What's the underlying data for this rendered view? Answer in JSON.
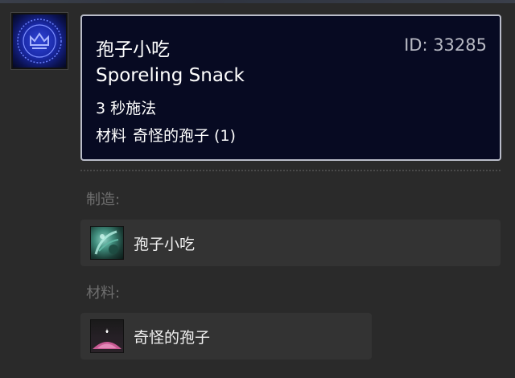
{
  "spell": {
    "icon_name": "blue-guild-crest-icon",
    "name_zh": "孢子小吃",
    "id_text": "ID: 33285",
    "name_en": "Sporeling Snack",
    "cast_time": "3 秒施法",
    "reagent_label": "材料",
    "reagent_value": "奇怪的孢子 (1)"
  },
  "creates": {
    "label": "制造:",
    "items": [
      {
        "name": "孢子小吃",
        "icon": "sporeling-snack-icon"
      }
    ]
  },
  "reagents": {
    "label": "材料:",
    "items": [
      {
        "name": "奇怪的孢子",
        "icon": "strange-spore-icon"
      }
    ]
  },
  "colors": {
    "background": "#2a2a2a",
    "tooltip_bg": "#070a22",
    "tooltip_border": "#b9bcc8",
    "row_bg": "#333333",
    "label_gray": "#6e6e6e"
  }
}
